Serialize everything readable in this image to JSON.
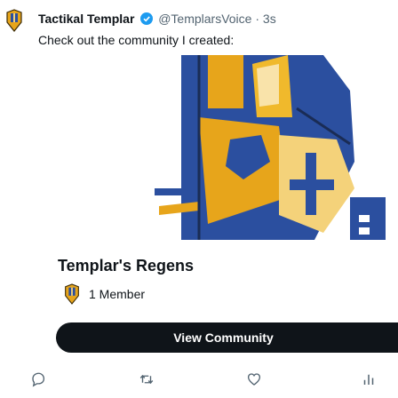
{
  "tweet": {
    "author_name": "Tactikal Templar",
    "author_handle": "@TemplarsVoice",
    "separator": "·",
    "time": "3s",
    "text": "Check out the community I created:"
  },
  "community_card": {
    "name": "Templar's Regens",
    "member_count": "1 Member",
    "view_button_label": "View Community"
  },
  "actions": [
    "reply-icon",
    "retweet-icon",
    "like-icon",
    "analytics-icon"
  ],
  "colors": {
    "text_primary": "#0f1419",
    "text_secondary": "#536471",
    "verified_blue": "#1d9bf0",
    "button_bg": "#0f1419",
    "banner_gold": "#e7a51b",
    "banner_blue": "#2b4f9f"
  }
}
